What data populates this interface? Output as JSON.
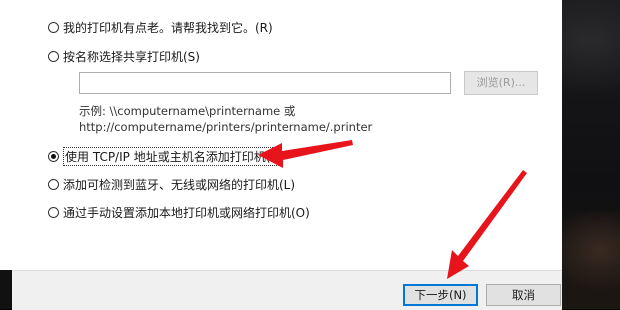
{
  "dialog": {
    "options": [
      {
        "label": "我的打印机有点老。请帮我找到它。(R)",
        "checked": false
      },
      {
        "label": "按名称选择共享打印机(S)",
        "checked": false
      },
      {
        "label": "使用 TCP/IP 地址或主机名添加打印机(I)",
        "checked": true
      },
      {
        "label": "添加可检测到蓝牙、无线或网络的打印机(L)",
        "checked": false
      },
      {
        "label": "通过手动设置添加本地打印机或网络打印机(O)",
        "checked": false
      }
    ],
    "shared_printer_input": {
      "value": ""
    },
    "browse_label": "浏览(R)...",
    "example_line1": "示例: \\\\computername\\printername 或",
    "example_line2": "http://computername/printers/printername/.printer"
  },
  "footer": {
    "next_label": "下一步(N)",
    "cancel_label": "取消"
  },
  "annotation": {
    "arrow_color": "#e8141c"
  }
}
